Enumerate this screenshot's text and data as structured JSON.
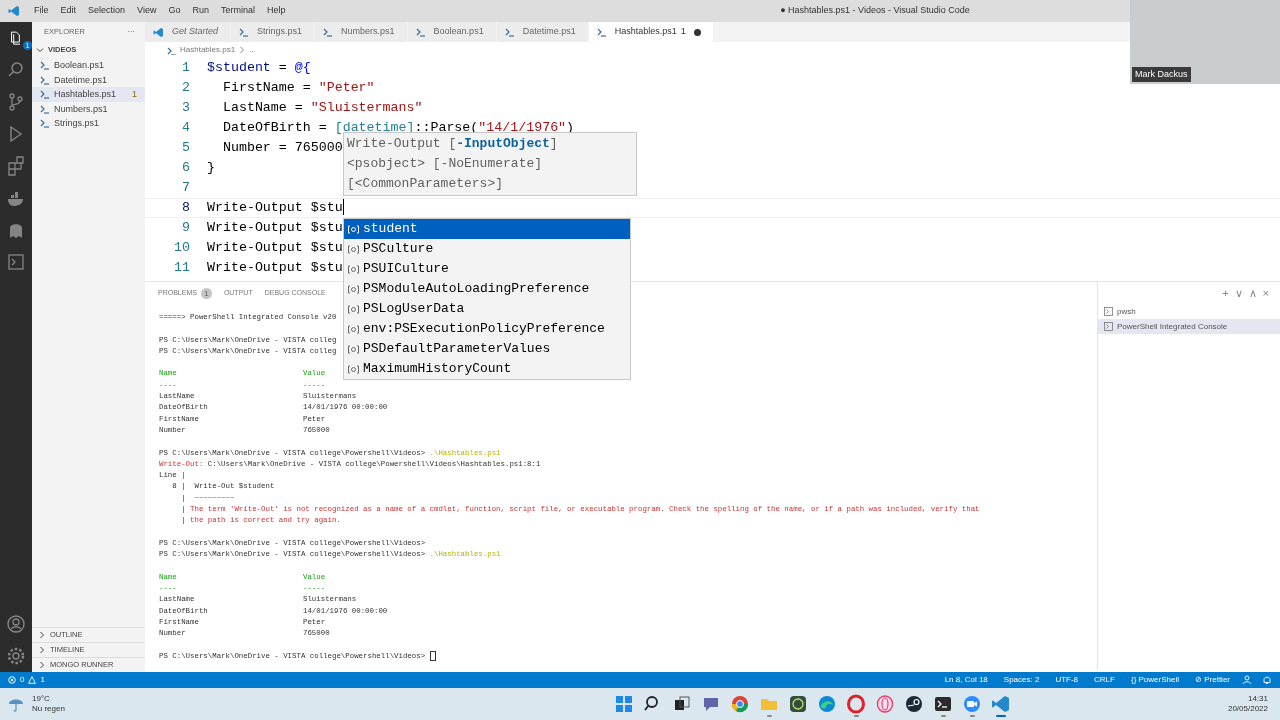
{
  "window": {
    "title": "● Hashtables.ps1 - Videos - Visual Studio Code"
  },
  "menu": [
    "File",
    "Edit",
    "Selection",
    "View",
    "Go",
    "Run",
    "Terminal",
    "Help"
  ],
  "video": {
    "caption": "Mark Dackus"
  },
  "activity_bar": {
    "explorer_badge": "1"
  },
  "sidebar": {
    "title": "EXPLORER",
    "more": "···",
    "section": "VIDEOS",
    "files": [
      {
        "name": "Boolean.ps1",
        "selected": false
      },
      {
        "name": "Datetime.ps1",
        "selected": false
      },
      {
        "name": "Hashtables.ps1",
        "selected": true,
        "badge": "1"
      },
      {
        "name": "Numbers.ps1",
        "selected": false
      },
      {
        "name": "Strings.ps1",
        "selected": false
      }
    ],
    "bottom_sections": [
      "OUTLINE",
      "TIMELINE",
      "MONGO RUNNER"
    ]
  },
  "tabs": [
    {
      "label": "Get Started",
      "kind": "welcome",
      "selected": false,
      "modified": false
    },
    {
      "label": "Strings.ps1",
      "kind": "script",
      "selected": false,
      "modified": false
    },
    {
      "label": "Numbers.ps1",
      "kind": "script",
      "selected": false,
      "modified": false
    },
    {
      "label": "Boolean.ps1",
      "kind": "script",
      "selected": false,
      "modified": false
    },
    {
      "label": "Datetime.ps1",
      "kind": "script",
      "selected": false,
      "modified": false
    },
    {
      "label": "Hashtables.ps1",
      "kind": "script",
      "selected": true,
      "modified": true,
      "badge": "1"
    }
  ],
  "breadcrumb": [
    "Hashtables.ps1",
    "..."
  ],
  "code": [
    {
      "number": "1",
      "current": false,
      "tokens": [
        {
          "text": "$student",
          "kind": "variable"
        },
        {
          "text": " = ",
          "kind": "plain"
        },
        {
          "text": "@{",
          "kind": "keyword"
        }
      ]
    },
    {
      "number": "2",
      "current": false,
      "tokens": [
        {
          "text": "  FirstName = ",
          "kind": "plain"
        },
        {
          "text": "\"Peter\"",
          "kind": "string"
        }
      ]
    },
    {
      "number": "3",
      "current": false,
      "tokens": [
        {
          "text": "  LastName = ",
          "kind": "plain"
        },
        {
          "text": "\"Sluistermans\"",
          "kind": "string"
        }
      ]
    },
    {
      "number": "4",
      "current": false,
      "tokens": [
        {
          "text": "  DateOfBirth = ",
          "kind": "plain"
        },
        {
          "text": "[datetime]",
          "kind": "type"
        },
        {
          "text": "::Parse(",
          "kind": "plain"
        },
        {
          "text": "\"14/1/1976\"",
          "kind": "string"
        },
        {
          "text": ")",
          "kind": "plain"
        }
      ]
    },
    {
      "number": "5",
      "current": false,
      "tokens": [
        {
          "text": "  Number = 765000",
          "kind": "plain"
        }
      ]
    },
    {
      "number": "6",
      "current": false,
      "tokens": [
        {
          "text": "}",
          "kind": "plain"
        }
      ]
    },
    {
      "number": "7",
      "current": false
    },
    {
      "number": "8",
      "current": true,
      "tokens": [
        {
          "text": "Write-Output $stu",
          "kind": "plain"
        }
      ]
    },
    {
      "number": "9",
      "current": false,
      "tokens": [
        {
          "text": "Write-Output $stu",
          "kind": "plain"
        }
      ]
    },
    {
      "number": "10",
      "current": false,
      "tokens": [
        {
          "text": "Write-Output $stu",
          "kind": "plain"
        }
      ]
    },
    {
      "number": "11",
      "current": false,
      "tokens": [
        {
          "text": "Write-Output $stu",
          "kind": "plain"
        }
      ]
    }
  ],
  "parameter_hint": [
    "Write-Output [**-InputObject**]",
    "<psobject> [-NoEnumerate]",
    "[<CommonParameters>]"
  ],
  "suggestions": [
    {
      "label": "student",
      "selected": true
    },
    {
      "label": "PSCulture",
      "selected": false
    },
    {
      "label": "PSUICulture",
      "selected": false
    },
    {
      "label": "PSModuleAutoLoadingPreference",
      "selected": false
    },
    {
      "label": "PSLogUserData",
      "selected": false
    },
    {
      "label": "env:PSExecutionPolicyPreference",
      "selected": false
    },
    {
      "label": "PSDefaultParameterValues",
      "selected": false
    },
    {
      "label": "MaximumHistoryCount",
      "selected": false
    }
  ],
  "panel": {
    "tabs": [
      {
        "label": "PROBLEMS",
        "badge": "1"
      },
      {
        "label": "OUTPUT"
      },
      {
        "label": "DEBUG CONSOLE"
      }
    ],
    "actions": [
      "+",
      "∨",
      "∧",
      "×"
    ],
    "terminals": [
      {
        "label": "pwsh",
        "selected": false
      },
      {
        "label": "PowerShell Integrated Console",
        "selected": true
      }
    ],
    "terminal_lines": [
      {
        "kind": "text",
        "segments": [
          {
            "text": "=====> PowerShell Integrated Console v20",
            "kind": "plain"
          }
        ]
      },
      {
        "kind": "blank"
      },
      {
        "kind": "text",
        "segments": [
          {
            "text": "PS C:\\Users\\Mark\\OneDrive - VISTA colleg",
            "kind": "plain"
          }
        ]
      },
      {
        "kind": "text",
        "segments": [
          {
            "text": "PS C:\\Users\\Mark\\OneDrive - VISTA colleg",
            "kind": "plain"
          }
        ]
      },
      {
        "kind": "blank"
      },
      {
        "kind": "header",
        "name": "Name",
        "value": "Value"
      },
      {
        "kind": "header",
        "name": "----",
        "value": "-----"
      },
      {
        "kind": "pair",
        "name": "LastName",
        "value": "Sluistermans"
      },
      {
        "kind": "pair",
        "name": "DateOfBirth",
        "value": "14/01/1976 00:00:00"
      },
      {
        "kind": "pair",
        "name": "FirstName",
        "value": "Peter"
      },
      {
        "kind": "pair",
        "name": "Number",
        "value": "765000"
      },
      {
        "kind": "blank"
      },
      {
        "kind": "text",
        "segments": [
          {
            "text": "PS C:\\Users\\Mark\\OneDrive - VISTA college\\Powershell\\Videos> ",
            "kind": "plain"
          },
          {
            "text": ".\\Hashtables.ps1",
            "kind": "command"
          }
        ]
      },
      {
        "kind": "text",
        "segments": [
          {
            "text": "Write-Out:",
            "kind": "error"
          },
          {
            "text": " C:\\Users\\Mark\\OneDrive - VISTA college\\Powershell\\Videos\\Hashtables.ps1:8:1",
            "kind": "plain"
          }
        ]
      },
      {
        "kind": "text",
        "segments": [
          {
            "text": "Line |",
            "kind": "plain"
          }
        ]
      },
      {
        "kind": "text",
        "segments": [
          {
            "text": "   8 |  Write-Out $student",
            "kind": "plain"
          }
        ]
      },
      {
        "kind": "text",
        "segments": [
          {
            "text": "     |  ",
            "kind": "plain"
          },
          {
            "text": "~~~~~~~~~",
            "kind": "error"
          }
        ]
      },
      {
        "kind": "text",
        "segments": [
          {
            "text": "     | ",
            "kind": "plain"
          },
          {
            "text": "The term 'Write-Out' is not recognized as a name of a cmdlet, function, script file, or executable program. Check the spelling of the name, or if a path was included, verify that",
            "kind": "error"
          }
        ]
      },
      {
        "kind": "text",
        "segments": [
          {
            "text": "     | ",
            "kind": "plain"
          },
          {
            "text": "the path is correct and try again.",
            "kind": "error"
          }
        ]
      },
      {
        "kind": "blank"
      },
      {
        "kind": "text",
        "segments": [
          {
            "text": "PS C:\\Users\\Mark\\OneDrive - VISTA college\\Powershell\\Videos>",
            "kind": "plain"
          }
        ]
      },
      {
        "kind": "text",
        "segments": [
          {
            "text": "PS C:\\Users\\Mark\\OneDrive - VISTA college\\Powershell\\Videos> ",
            "kind": "plain"
          },
          {
            "text": ".\\Hashtables.ps1",
            "kind": "command"
          }
        ]
      },
      {
        "kind": "blank"
      },
      {
        "kind": "header",
        "name": "Name",
        "value": "Value"
      },
      {
        "kind": "header",
        "name": "----",
        "value": "-----"
      },
      {
        "kind": "pair",
        "name": "LastName",
        "value": "Sluistermans"
      },
      {
        "kind": "pair",
        "name": "DateOfBirth",
        "value": "14/01/1976 00:00:00"
      },
      {
        "kind": "pair",
        "name": "FirstName",
        "value": "Peter"
      },
      {
        "kind": "pair",
        "name": "Number",
        "value": "765000"
      },
      {
        "kind": "blank"
      },
      {
        "kind": "prompt",
        "segments": [
          {
            "text": "PS C:\\Users\\Mark\\OneDrive - VISTA college\\Powershell\\Videos> ",
            "kind": "plain"
          }
        ]
      }
    ]
  },
  "status_bar": {
    "problems": [
      {
        "kind": "error",
        "count": "0"
      },
      {
        "kind": "warning",
        "count": "1"
      }
    ],
    "items": [
      "Ln 8, Col 18",
      "Spaces: 2",
      "UTF-8",
      "CRLF",
      "{} PowerShell",
      "⊘ Prettier"
    ]
  },
  "taskbar": {
    "weather": {
      "temperature": "19°C",
      "condition": "Nu regen"
    },
    "apps": [
      {
        "kind": "start",
        "running": false
      },
      {
        "kind": "search",
        "running": false
      },
      {
        "kind": "taskview",
        "running": false
      },
      {
        "kind": "chat",
        "running": false
      },
      {
        "kind": "browser",
        "running": false
      },
      {
        "kind": "folder",
        "running": true
      },
      {
        "kind": "app",
        "running": false
      },
      {
        "kind": "edge",
        "running": false
      },
      {
        "kind": "o-ring",
        "running": true
      },
      {
        "kind": "ring",
        "running": false
      },
      {
        "kind": "steam",
        "running": false
      },
      {
        "kind": "terminal",
        "running": true
      },
      {
        "kind": "camera",
        "running": true
      },
      {
        "kind": "code",
        "running": true
      }
    ],
    "time": "14:31",
    "date": "20/05/2022"
  }
}
